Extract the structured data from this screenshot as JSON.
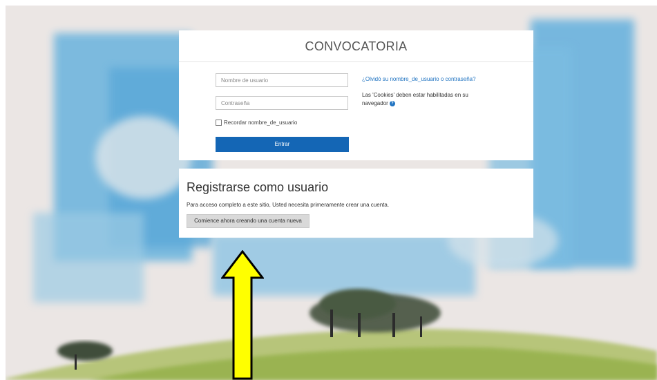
{
  "login": {
    "title": "CONVOCATORIA",
    "username_placeholder": "Nombre de usuario",
    "password_placeholder": "Contraseña",
    "remember_label": "Recordar nombre_de_usuario",
    "login_button": "Entrar",
    "forgot_link": "¿Olvidó su nombre_de_usuario o contraseña?",
    "cookies_notice": "Las 'Cookies' deben estar habilitadas en su navegador"
  },
  "signup": {
    "title": "Registrarse como usuario",
    "description": "Para acceso completo a este sitio, Usted necesita primeramente crear una cuenta.",
    "create_account_button": "Comience ahora creando una cuenta nueva"
  },
  "colors": {
    "primary_button": "#1466b5",
    "link": "#1f73c1",
    "annotation_arrow": "#ffff00"
  },
  "icons": {
    "help": "question-circle-icon",
    "annotation": "up-arrow"
  }
}
